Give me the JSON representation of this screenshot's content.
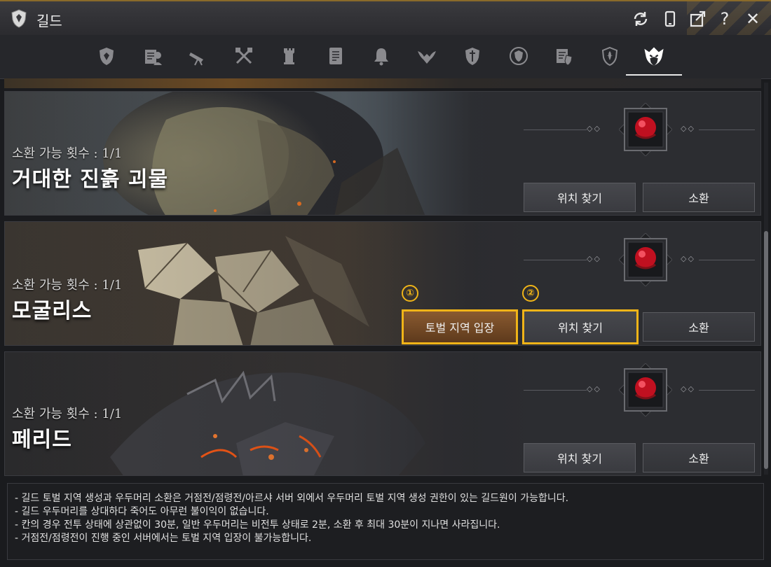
{
  "window": {
    "title": "길드",
    "buttons": [
      "refresh-icon",
      "mobile-icon",
      "popout-icon",
      "help-icon",
      "close-icon"
    ],
    "help_label": "?",
    "close_label": "✕"
  },
  "tabs": [
    {
      "icon": "guild-shield-icon"
    },
    {
      "icon": "guild-scroll-icon"
    },
    {
      "icon": "telescope-icon"
    },
    {
      "icon": "crossed-weapons-icon"
    },
    {
      "icon": "tower-icon"
    },
    {
      "icon": "notice-board-icon"
    },
    {
      "icon": "bell-icon"
    },
    {
      "icon": "winged-crest-icon"
    },
    {
      "icon": "shield-sword-icon"
    },
    {
      "icon": "round-emblem-icon"
    },
    {
      "icon": "scroll-emblem-icon"
    },
    {
      "icon": "fleur-shield-icon"
    },
    {
      "icon": "boss-head-icon",
      "selected": true
    }
  ],
  "bosses": [
    {
      "count_label": "소환 가능 횟수 : 1/1",
      "name": "거대한 진흙 괴물",
      "buttons": {
        "locate": "위치 찾기",
        "summon": "소환"
      }
    },
    {
      "count_label": "소환 가능 횟수 : 1/1",
      "name": "모굴리스",
      "buttons": {
        "enter": "토벌 지역 입장",
        "locate": "위치 찾기",
        "summon": "소환"
      },
      "markers": [
        "①",
        "②"
      ]
    },
    {
      "count_label": "소환 가능 횟수 : 1/1",
      "name": "페리드",
      "buttons": {
        "locate": "위치 찾기",
        "summon": "소환"
      }
    }
  ],
  "gem_dots": "◇◇",
  "notes": [
    "- 길드 토벌 지역 생성과 우두머리 소환은 거점전/점령전/아르샤 서버 외에서 우두머리 토벌 지역 생성 권한이 있는 길드원이 가능합니다.",
    "- 길드 우두머리를 상대하다 죽어도 아무런 불이익이 없습니다.",
    "- 칸의 경우 전투 상태에 상관없이 30분, 일반 우두머리는 비전투 상태로 2분, 소환 후 최대 30분이 지나면 사라집니다.",
    "- 거점전/점령전이 진행 중인 서버에서는 토벌 지역 입장이 불가능합니다."
  ],
  "colors": {
    "highlight": "#f0b418",
    "accent_gold": "#8a6a2a",
    "gem_red": "#d0182a"
  }
}
